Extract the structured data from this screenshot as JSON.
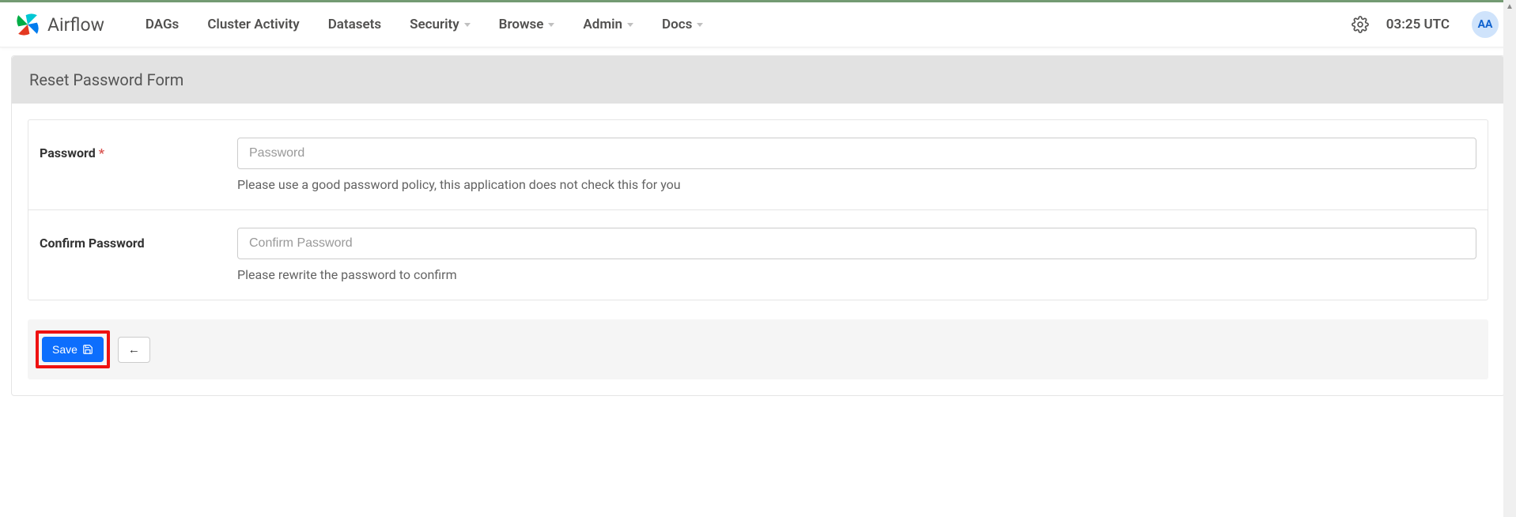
{
  "brand": {
    "text": "Airflow"
  },
  "nav": {
    "items": [
      {
        "label": "DAGs",
        "dropdown": false
      },
      {
        "label": "Cluster Activity",
        "dropdown": false
      },
      {
        "label": "Datasets",
        "dropdown": false
      },
      {
        "label": "Security",
        "dropdown": true
      },
      {
        "label": "Browse",
        "dropdown": true
      },
      {
        "label": "Admin",
        "dropdown": true
      },
      {
        "label": "Docs",
        "dropdown": true
      }
    ],
    "clock": "03:25 UTC",
    "avatar": "AA"
  },
  "panel": {
    "title": "Reset Password Form"
  },
  "form": {
    "rows": [
      {
        "label": "Password",
        "required": true,
        "placeholder": "Password",
        "help": "Please use a good password policy, this application does not check this for you"
      },
      {
        "label": "Confirm Password",
        "required": false,
        "placeholder": "Confirm Password",
        "help": "Please rewrite the password to confirm"
      }
    ]
  },
  "actions": {
    "save": "Save"
  },
  "highlight": {
    "save_button": true
  }
}
